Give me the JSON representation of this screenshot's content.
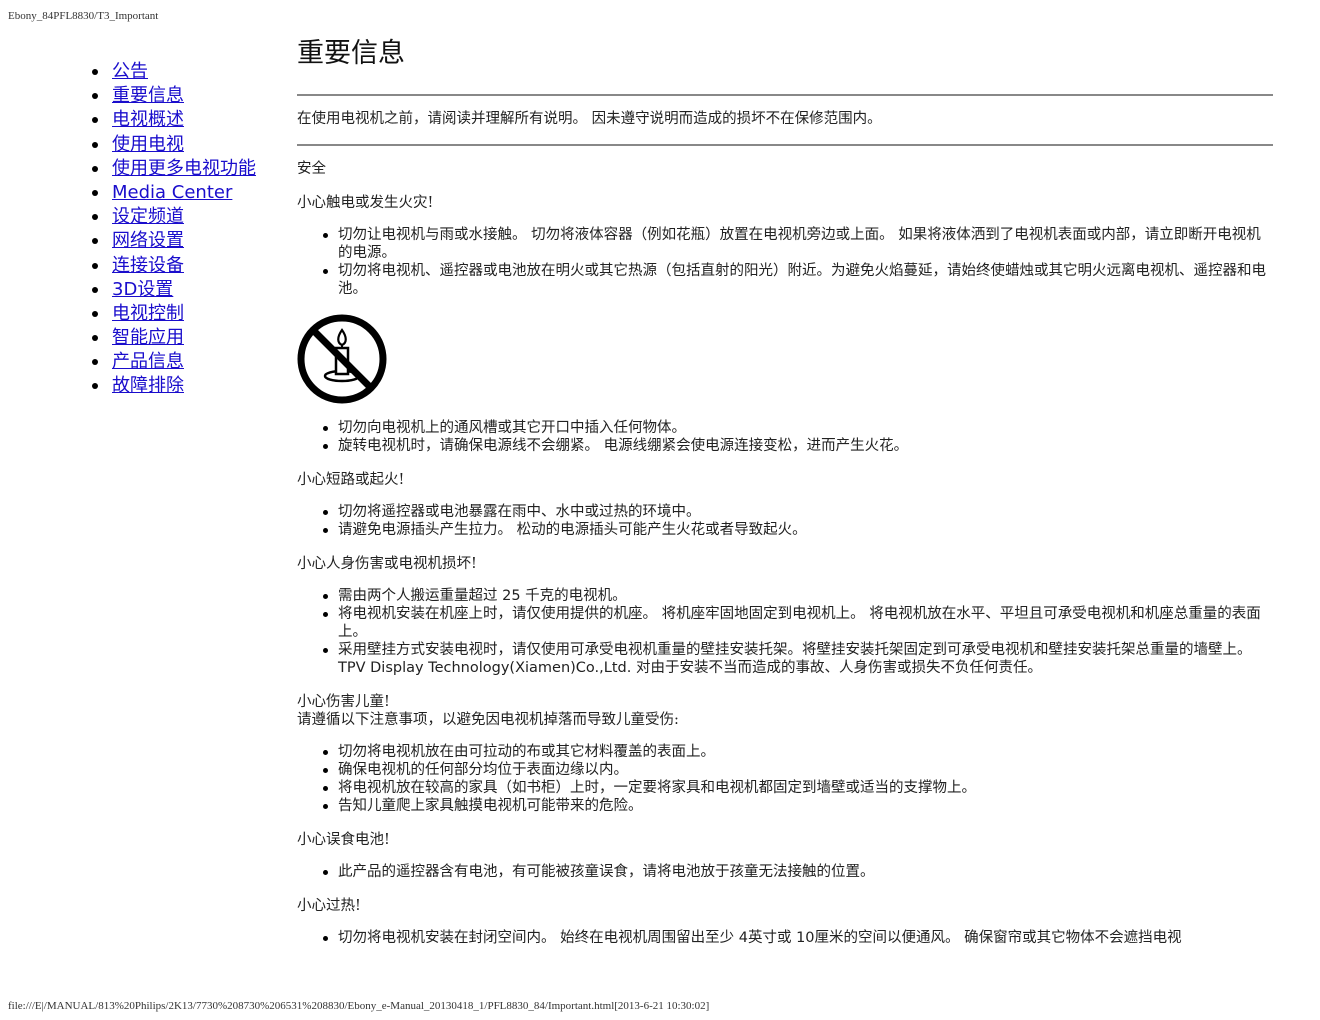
{
  "print": {
    "header": "Ebony_84PFL8830/T3_Important",
    "footer": "file:///E|/MANUAL/813%20Philips/2K13/7730%208730%206531%208830/Ebony_e-Manual_20130418_1/PFL8830_84/Important.html[2013-6-21 10:30:02]"
  },
  "nav": {
    "items": [
      {
        "label": "公告"
      },
      {
        "label": "重要信息"
      },
      {
        "label": "电视概述"
      },
      {
        "label": "使用电视"
      },
      {
        "label": "使用更多电视功能"
      },
      {
        "label": "Media Center"
      },
      {
        "label": "设定频道"
      },
      {
        "label": "网络设置"
      },
      {
        "label": "连接设备"
      },
      {
        "label": "3D设置"
      },
      {
        "label": "电视控制"
      },
      {
        "label": "智能应用"
      },
      {
        "label": "产品信息"
      },
      {
        "label": "故障排除"
      }
    ]
  },
  "page": {
    "title": "重要信息",
    "intro": "在使用电视机之前，请阅读并理解所有说明。 因未遵守说明而造成的损坏不在保修范围内。",
    "safety_heading": "安全",
    "fire": {
      "heading": "小心触电或发生火灾!",
      "items": [
        "切勿让电视机与雨或水接触。 切勿将液体容器（例如花瓶）放置在电视机旁边或上面。 如果将液体洒到了电视机表面或内部，请立即断开电视机的电源。",
        "切勿将电视机、遥控器或电池放在明火或其它热源（包括直射的阳光）附近。为避免火焰蔓延，请始终使蜡烛或其它明火远离电视机、遥控器和电池。"
      ],
      "items_after_icon": [
        "切勿向电视机上的通风槽或其它开口中插入任何物体。",
        "旋转电视机时，请确保电源线不会绷紧。 电源线绷紧会使电源连接变松，进而产生火花。"
      ]
    },
    "short_circuit": {
      "heading": "小心短路或起火!",
      "items": [
        "切勿将遥控器或电池暴露在雨中、水中或过热的环境中。",
        "请避免电源插头产生拉力。 松动的电源插头可能产生火花或者导致起火。"
      ]
    },
    "injury": {
      "heading": "小心人身伤害或电视机损坏!",
      "item1_pre": "需由两个人搬运重量超过 ",
      "item1_num": "25",
      "item1_post": " 千克的电视机。",
      "item2": "将电视机安装在机座上时，请仅使用提供的机座。 将机座牢固地固定到电视机上。 将电视机放在水平、平坦且可承受电视机和机座总重量的表面上。",
      "item3": "采用壁挂方式安装电视时，请仅使用可承受电视机重量的壁挂安装托架。将壁挂安装托架固定到可承受电视机和壁挂安装托架总重量的墙壁上。",
      "item3_company": "TPV Display Technology(Xiamen)Co.,Ltd.",
      "item3_tail": " 对由于安装不当而造成的事故、人身伤害或损失不负任何责任。"
    },
    "children": {
      "heading": "小心伤害儿童!",
      "intro": "请遵循以下注意事项，以避免因电视机掉落而导致儿童受伤:",
      "items": [
        "切勿将电视机放在由可拉动的布或其它材料覆盖的表面上。",
        "确保电视机的任何部分均位于表面边缘以内。",
        "将电视机放在较高的家具（如书柜）上时，一定要将家具和电视机都固定到墙壁或适当的支撑物上。",
        "告知儿童爬上家具触摸电视机可能带来的危险。"
      ]
    },
    "battery": {
      "heading": "小心误食电池!",
      "items": [
        "此产品的遥控器含有电池，有可能被孩童误食，请将电池放于孩童无法接触的位置。"
      ]
    },
    "overheat": {
      "heading": "小心过热!",
      "seg1": "切勿将电视机安装在封闭空间内。 始终在电视机周围留出至少 ",
      "num1": "4",
      "seg2": "英寸或 ",
      "num2": "10",
      "seg3": "厘米的空间以便通风。 确保窗帘或其它物体不会遮挡电视"
    }
  },
  "icons": {
    "no_open_flame": "no-candle-warning-icon"
  }
}
